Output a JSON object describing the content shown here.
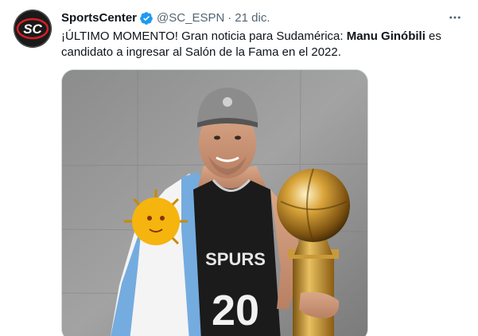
{
  "tweet": {
    "author_name": "SportsCenter",
    "handle": "@SC_ESPN",
    "separator": "·",
    "date": "21 dic.",
    "more_label": "···",
    "text_part1": "¡ÚLTIMO MOMENTO! Gran noticia para Sudamérica: ",
    "text_bold": "Manu Ginóbili",
    "text_part2": " es candidato a ingresar al Salón de la Fama en el 2022.",
    "avatar_logo": "SC",
    "jersey_text": "SPURS",
    "jersey_number": "20"
  },
  "icons": {
    "verified": "verified-badge-icon",
    "more": "more-options-icon"
  },
  "colors": {
    "verified_blue": "#1d9bf0",
    "text_primary": "#0f1419",
    "text_secondary": "#536471",
    "brand_red": "#d71f26"
  }
}
